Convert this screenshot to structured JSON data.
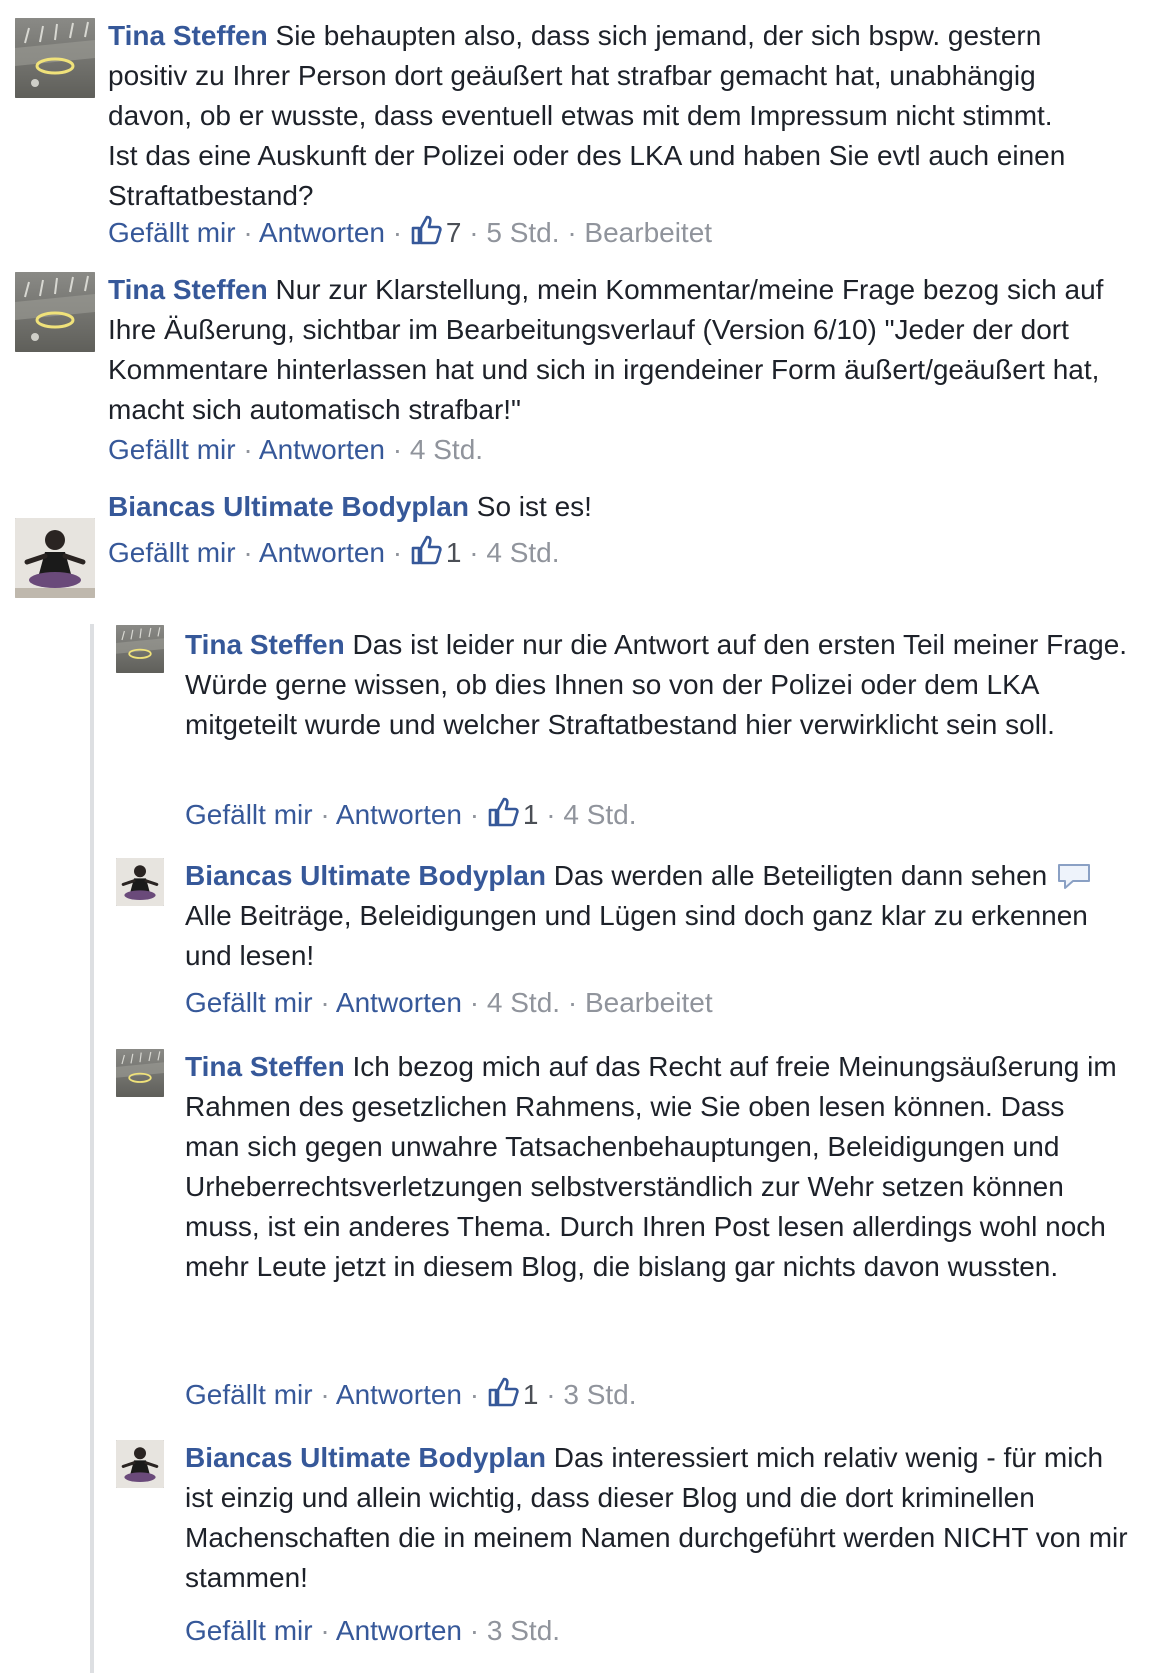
{
  "comments": [
    {
      "author": "Tina Steffen",
      "text": "Sie behaupten also, dass sich jemand, der sich bspw. gestern positiv zu Ihrer Person dort geäußert hat strafbar gemacht hat, unabhängig davon, ob er wusste, dass eventuell etwas mit dem Impressum nicht stimmt. Ist das eine Auskunft der Polizei oder des LKA und haben Sie evtl auch einen Straftatbestand?",
      "like": "Gefällt mir",
      "reply": "Antworten",
      "likes": "7",
      "time": "5 Std.",
      "edited": "Bearbeitet"
    },
    {
      "author": "Tina Steffen",
      "text": "Nur zur Klarstellung, mein Kommentar/meine Frage bezog sich auf Ihre Äußerung, sichtbar im Bearbeitungsverlauf (Version 6/10) \"Jeder der dort Kommentare hinterlassen hat und sich in irgendeiner Form äußert/geäußert hat, macht sich automatisch strafbar!\"",
      "like": "Gefällt mir",
      "reply": "Antworten",
      "time": "4 Std."
    },
    {
      "author": "Biancas Ultimate Bodyplan",
      "text": "So ist es!",
      "like": "Gefällt mir",
      "reply": "Antworten",
      "likes": "1",
      "time": "4 Std."
    }
  ],
  "replies": [
    {
      "author": "Tina Steffen",
      "text": "Das ist leider nur die Antwort auf den ersten Teil meiner Frage. Würde gerne wissen, ob dies Ihnen so von der Polizei oder dem LKA mitgeteilt wurde und welcher Straftatbestand hier verwirklicht sein soll.",
      "like": "Gefällt mir",
      "reply": "Antworten",
      "likes": "1",
      "time": "4 Std."
    },
    {
      "author": "Biancas Ultimate Bodyplan",
      "text_a": "Das werden alle Beteiligten dann sehen",
      "text_b": "Alle Beiträge, Beleidigungen und Lügen sind doch ganz klar zu erkennen und lesen!",
      "like": "Gefällt mir",
      "reply": "Antworten",
      "time": "4 Std.",
      "edited": "Bearbeitet"
    },
    {
      "author": "Tina Steffen",
      "text": "Ich bezog mich auf das Recht auf freie Meinungsäußerung im Rahmen des gesetzlichen Rahmens, wie Sie oben lesen können. Dass man sich gegen unwahre Tatsachenbehauptungen, Beleidigungen und Urheberrechtsverletzungen selbstverständlich zur Wehr setzen können muss, ist ein anderes Thema. Durch Ihren Post lesen allerdings wohl noch mehr Leute jetzt in diesem Blog, die bislang gar nichts davon wussten.",
      "like": "Gefällt mir",
      "reply": "Antworten",
      "likes": "1",
      "time": "3 Std."
    },
    {
      "author": "Biancas Ultimate Bodyplan",
      "text": "Das interessiert mich relativ wenig - für mich ist einzig und allein wichtig, dass dieser Blog und die dort kriminellen Machenschaften die in meinem Namen durchgeführt werden NICHT von mir stammen!",
      "like": "Gefällt mir",
      "reply": "Antworten",
      "time": "3 Std."
    }
  ],
  "separator": "·",
  "icons": {
    "like": "thumbs-up-icon",
    "avatar_tina": "tina-steffen-avatar",
    "avatar_bianca": "biancas-bodyplan-avatar",
    "emoji": "speech-bubble-emoji-icon"
  },
  "colors": {
    "author": "#365899",
    "meta": "#90949c",
    "text": "#1d2129",
    "rule": "#dddfe2"
  }
}
